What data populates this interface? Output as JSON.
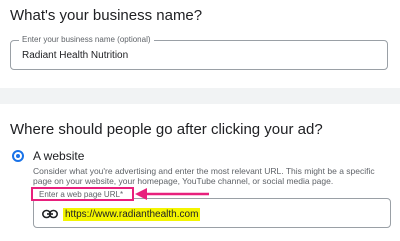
{
  "business": {
    "heading": "What's your business name?",
    "field_label": "Enter your business name (optional)",
    "field_value": "Radiant Health Nutrition"
  },
  "destination": {
    "heading": "Where should people go after clicking your ad?",
    "option_label": "A website",
    "option_selected": true,
    "description": "Consider what you're advertising and enter the most relevant URL. This might be a specific page on your website, your homepage, YouTube channel, or social media page.",
    "url_label": "Enter a web page URL*",
    "url_value": "https://www.radianthealth.com",
    "url_icon": "link-icon"
  },
  "colors": {
    "accent_blue": "#1a73e8",
    "annotation_pink": "#e8207c",
    "highlight_yellow": "#f4f500",
    "divider_gray": "#f1f3f4"
  }
}
